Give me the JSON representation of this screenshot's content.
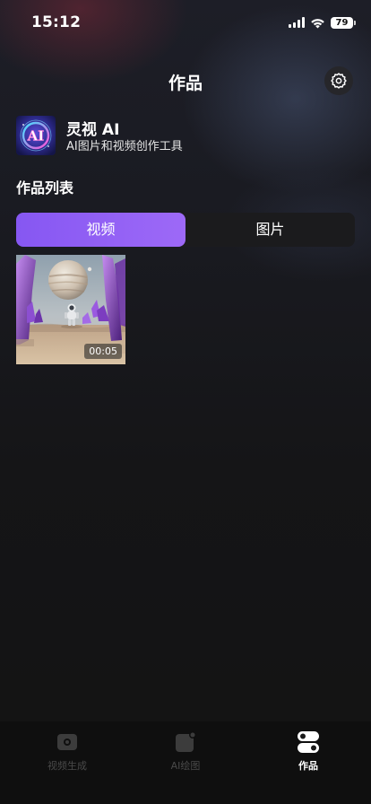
{
  "status_bar": {
    "time": "15:12",
    "battery": "79",
    "icons": [
      "signal-icon",
      "wifi-icon",
      "battery-icon"
    ]
  },
  "header": {
    "title": "作品",
    "settings_icon": "gear-icon"
  },
  "app": {
    "name": "灵视 AI",
    "subtitle": "AI图片和视频创作工具",
    "logo_text": "AI"
  },
  "section": {
    "title": "作品列表"
  },
  "tabs": [
    {
      "label": "视频",
      "selected": true
    },
    {
      "label": "图片",
      "selected": false
    }
  ],
  "works": [
    {
      "type": "video",
      "duration": "00:05",
      "thumbnail": "astronaut on desert planet with purple crystals"
    }
  ],
  "bottom_nav": [
    {
      "label": "视频生成",
      "icon": "video-camera-icon",
      "active": false
    },
    {
      "label": "AI绘图",
      "icon": "image-brush-icon",
      "active": false
    },
    {
      "label": "作品",
      "icon": "toggles-icon",
      "active": true
    }
  ],
  "colors": {
    "accent_start": "#8657f2",
    "accent_end": "#9d69f7",
    "background": "#141416"
  }
}
